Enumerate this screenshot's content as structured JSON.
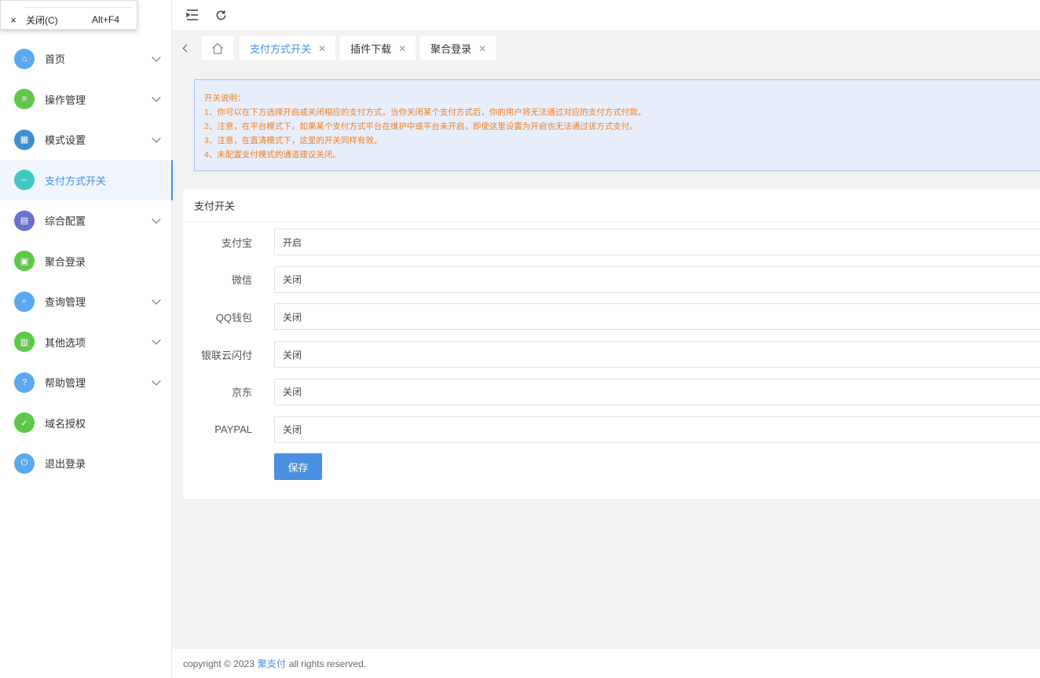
{
  "context_menu": {
    "close_label": "关闭(C)",
    "close_shortcut": "Alt+F4",
    "close_icon": "×"
  },
  "sidebar": {
    "items": [
      {
        "label": "首页",
        "color": "#5aa9f0",
        "icon": "⌂",
        "has_chevron": true
      },
      {
        "label": "操作管理",
        "color": "#5fc84a",
        "icon": "≡",
        "has_chevron": true
      },
      {
        "label": "模式设置",
        "color": "#3e8fd0",
        "icon": "▦",
        "has_chevron": true
      },
      {
        "label": "支付方式开关",
        "color": "#3fc9c2",
        "icon": "⇔",
        "has_chevron": false,
        "active": true
      },
      {
        "label": "综合配置",
        "color": "#6a6fd0",
        "icon": "▤",
        "has_chevron": true
      },
      {
        "label": "聚合登录",
        "color": "#5fc84a",
        "icon": "▣",
        "has_chevron": false
      },
      {
        "label": "查询管理",
        "color": "#5aa9f0",
        "icon": "⌕",
        "has_chevron": true
      },
      {
        "label": "其他选项",
        "color": "#5fc84a",
        "icon": "▥",
        "has_chevron": true
      },
      {
        "label": "帮助管理",
        "color": "#5aa9f0",
        "icon": "?",
        "has_chevron": true
      },
      {
        "label": "域名授权",
        "color": "#5fc84a",
        "icon": "✓",
        "has_chevron": false
      },
      {
        "label": "退出登录",
        "color": "#5aa9f0",
        "icon": "⏻",
        "has_chevron": false
      }
    ]
  },
  "tabs": [
    {
      "label": "支付方式开关",
      "active": true
    },
    {
      "label": "插件下载",
      "active": false
    },
    {
      "label": "聚合登录",
      "active": false
    }
  ],
  "notice": {
    "lines": [
      "开关说明：",
      "1、你可以在下方选择开启或关闭相应的支付方式，当你关闭某个支付方式后，你的用户将无法通过对应的支付方式付款。",
      "2、注意，在平台模式下，如果某个支付方式平台在维护中或平台未开启，即使这里设置为开启也无法通过该方式支付。",
      "3、注意，在直清模式下，这里的开关同样有效。",
      "4、未配置支付模式的通道建议关闭。"
    ]
  },
  "card": {
    "title": "支付开关",
    "fields": [
      {
        "label": "支付宝",
        "value": "开启"
      },
      {
        "label": "微信",
        "value": "关闭"
      },
      {
        "label": "QQ钱包",
        "value": "关闭"
      },
      {
        "label": "银联云闪付",
        "value": "关闭"
      },
      {
        "label": "京东",
        "value": "关闭"
      },
      {
        "label": "PAYPAL",
        "value": "关闭"
      }
    ],
    "save_label": "保存"
  },
  "footer": {
    "prefix": "copyright © 2023",
    "brand": "聚支付",
    "suffix": "all rights reserved."
  },
  "colors": {
    "accent": "#4a90e2",
    "notice_text": "#f07e20",
    "notice_bg": "#e8eefc"
  }
}
